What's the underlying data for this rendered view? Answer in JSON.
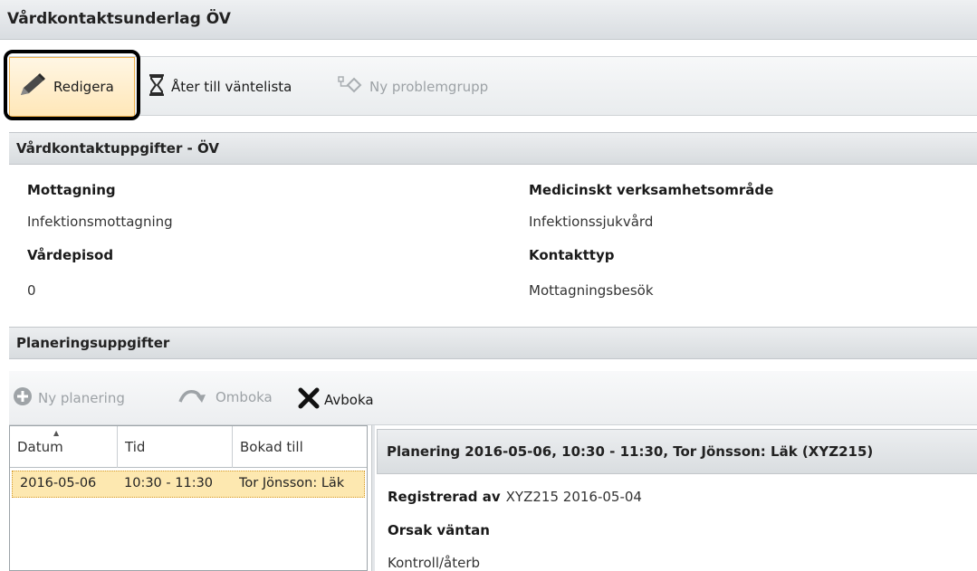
{
  "window": {
    "title": "Vårdkontaktsunderlag ÖV"
  },
  "toolbar": {
    "redigera": "Redigera",
    "ater": "Åter till väntelista",
    "ny_problemgrupp": "Ny problemgrupp"
  },
  "vardkontakt": {
    "header": "Vårdkontaktuppgifter - ÖV",
    "mottagning_label": "Mottagning",
    "mottagning_value": "Infektionsmottagning",
    "omrade_label": "Medicinskt verksamhetsområde",
    "omrade_value": "Infektionssjukvård",
    "vardepisod_label": "Vårdepisod",
    "vardepisod_value": "0",
    "kontakttyp_label": "Kontakttyp",
    "kontakttyp_value": "Mottagningsbesök"
  },
  "planering": {
    "header": "Planeringsuppgifter",
    "ny_planering": "Ny planering",
    "omboka": "Omboka",
    "avboka": "Avboka",
    "columns": {
      "datum": "Datum",
      "tid": "Tid",
      "bokad_till": "Bokad till"
    },
    "rows": [
      {
        "datum": "2016-05-06",
        "tid": "10:30 - 11:30",
        "bokad_till": "Tor Jönsson: Läk"
      }
    ]
  },
  "detail": {
    "header": "Planering 2016-05-06, 10:30 - 11:30, Tor Jönsson: Läk (XYZ215)",
    "registrerad_label": "Registrerad av",
    "registrerad_value": "XYZ215 2016-05-04",
    "orsak_label": "Orsak väntan",
    "orsak_value": "Kontroll/återb"
  }
}
